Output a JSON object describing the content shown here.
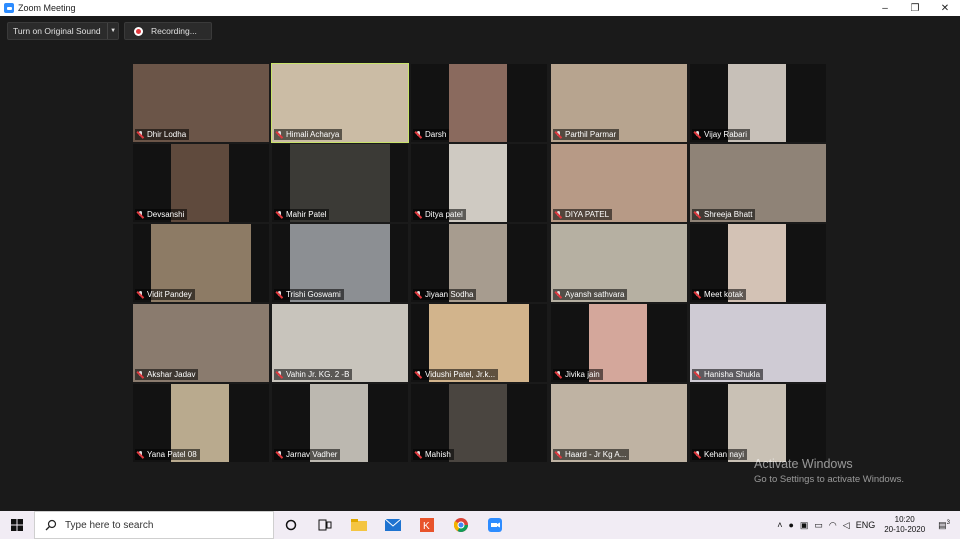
{
  "window": {
    "title": "Zoom Meeting",
    "minimize": "–",
    "maximize": "❐",
    "close": "✕"
  },
  "toolbar": {
    "sound_label": "Turn on Original Sound",
    "recording_label": "Recording..."
  },
  "participants": [
    {
      "name": "Dhir Lodha",
      "active": false
    },
    {
      "name": "Himali Acharya",
      "active": true
    },
    {
      "name": "Darsh",
      "active": false
    },
    {
      "name": "Parthil Parmar",
      "active": false
    },
    {
      "name": "Vijay Rabari",
      "active": false
    },
    {
      "name": "Devsanshi",
      "active": false
    },
    {
      "name": "Mahir Patel",
      "active": false
    },
    {
      "name": "Ditya patel",
      "active": false
    },
    {
      "name": "DIYA PATEL",
      "active": false
    },
    {
      "name": "Shreeja Bhatt",
      "active": false
    },
    {
      "name": "Vidit Pandey",
      "active": false
    },
    {
      "name": "Trishi Goswami",
      "active": false
    },
    {
      "name": "Jiyaan Sodha",
      "active": false
    },
    {
      "name": "Ayansh sathvara",
      "active": false
    },
    {
      "name": "Meet kotak",
      "active": false
    },
    {
      "name": "Akshar Jadav",
      "active": false
    },
    {
      "name": "Vahin Jr. KG. 2 -B",
      "active": false
    },
    {
      "name": "Vidushi Patel, Jr.k...",
      "active": false
    },
    {
      "name": "Jivika jain",
      "active": false
    },
    {
      "name": "Hanisha Shukla",
      "active": false
    },
    {
      "name": "Yana Patel 08",
      "active": false
    },
    {
      "name": "Jarnav Vadher",
      "active": false
    },
    {
      "name": "Mahish",
      "active": false
    },
    {
      "name": "Haard - Jr Kg A...",
      "active": false
    },
    {
      "name": "Kehan nayi",
      "active": false
    }
  ],
  "watermark": {
    "line1": "Activate Windows",
    "line2": "Go to Settings to activate Windows."
  },
  "taskbar": {
    "search_placeholder": "Type here to search",
    "lang": "ENG",
    "time": "10:20",
    "date": "20-10-2020",
    "notification_count": "3"
  }
}
